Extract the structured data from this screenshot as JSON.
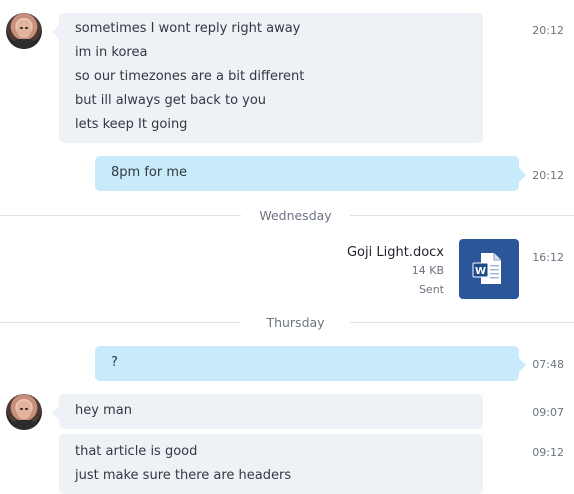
{
  "messages": [
    {
      "direction": "incoming",
      "lines": [
        "sometimes I wont reply right away",
        "im in korea",
        "so our timezones are a bit different",
        "but ill always get back to you",
        "lets keep It going"
      ],
      "time": "20:12"
    },
    {
      "direction": "outgoing",
      "lines": [
        "8pm for me"
      ],
      "time": "20:12"
    },
    {
      "direction": "outgoing",
      "lines": [
        "?"
      ],
      "time": "07:48"
    },
    {
      "direction": "incoming",
      "lines": [
        "hey man"
      ],
      "time": "09:07"
    },
    {
      "direction": "incoming",
      "lines": [
        "that article is good",
        "just make sure there are headers"
      ],
      "time": "09:12"
    }
  ],
  "day_separators": [
    "Wednesday",
    "Thursday"
  ],
  "file_message": {
    "file_name": "Goji Light.docx",
    "file_size": "14 KB",
    "status": "Sent",
    "time": "16:12",
    "icon": "word-document-icon",
    "tile_color": "#2b579a"
  },
  "colors": {
    "incoming_bubble": "#eef1f5",
    "outgoing_bubble": "#c7ebfb",
    "divider": "#dfe3e8",
    "timestamp": "#6b7480"
  }
}
